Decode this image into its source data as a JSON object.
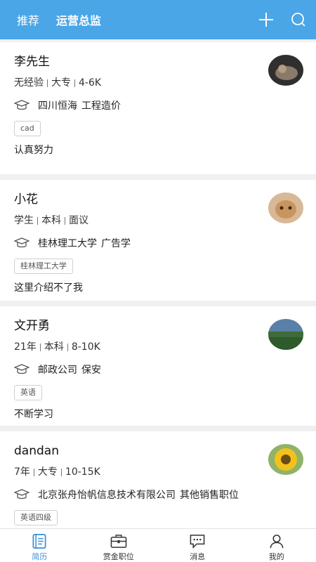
{
  "header": {
    "tabs": [
      {
        "label": "推荐"
      },
      {
        "label": "运营总监"
      }
    ]
  },
  "colors": {
    "header_bg": "#4aa6e6",
    "active_nav": "#3b8fd6"
  },
  "cards": [
    {
      "name": "李先生",
      "meta": [
        "无经验",
        "大专",
        "4-6K"
      ],
      "edu_school": "四川恒海",
      "edu_major": "工程造价",
      "tag": "cad",
      "intro": "认真努力",
      "avatar": "dog-photo"
    },
    {
      "name": "小花",
      "meta": [
        "学生",
        "本科",
        "面议"
      ],
      "edu_school": "桂林理工大学",
      "edu_major": "广告学",
      "tag": "桂林理工大学",
      "intro": "这里介绍不了我",
      "avatar": "cat-photo"
    },
    {
      "name": "文开勇",
      "meta": [
        "21年",
        "本科",
        "8-10K"
      ],
      "edu_school": "邮政公司",
      "edu_major": "保安",
      "tag": "英语",
      "intro": "不断学习",
      "avatar": "landscape-photo"
    },
    {
      "name": "dandan",
      "meta": [
        "7年",
        "大专",
        "10-15K"
      ],
      "edu_school": "北京张舟怡帆信息技术有限公司",
      "edu_major": "其他销售职位",
      "tag": "英语四级",
      "intro": "",
      "avatar": "sunflower-photo"
    }
  ],
  "bottom_nav": [
    {
      "label": "简历",
      "icon": "resume-icon",
      "active": true
    },
    {
      "label": "赏金职位",
      "icon": "briefcase-icon",
      "active": false
    },
    {
      "label": "消息",
      "icon": "message-icon",
      "active": false
    },
    {
      "label": "我的",
      "icon": "user-icon",
      "active": false
    }
  ]
}
